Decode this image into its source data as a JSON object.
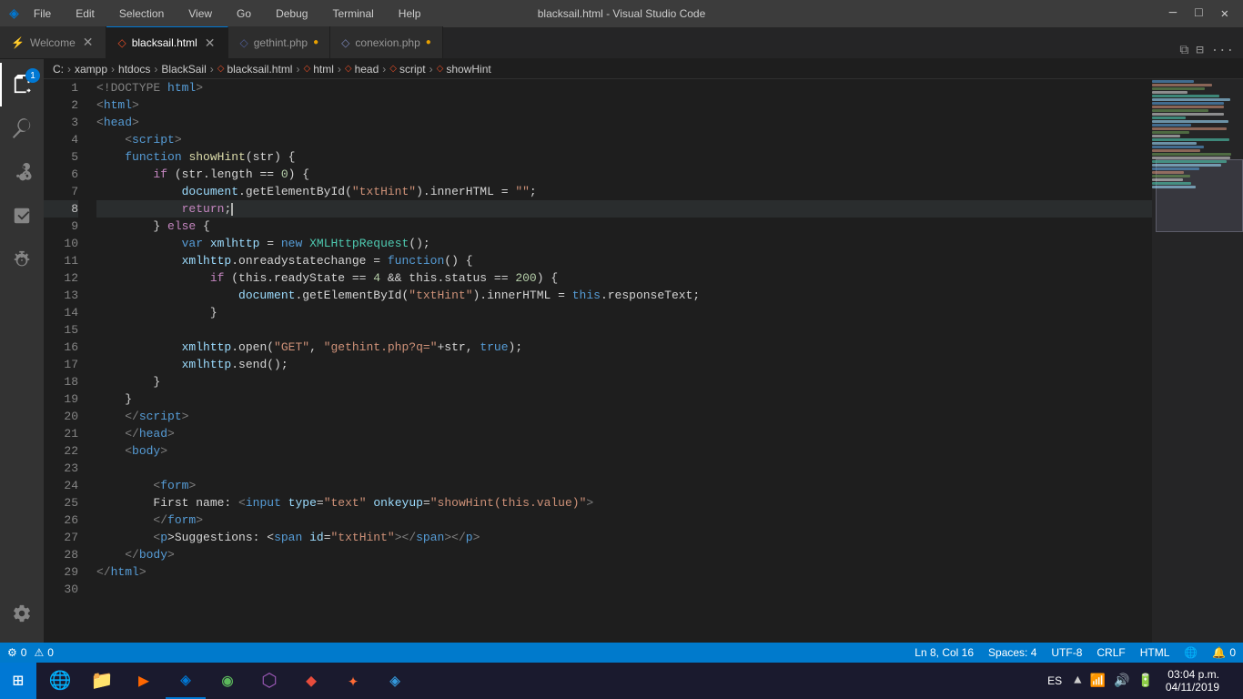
{
  "titlebar": {
    "menu_items": [
      "File",
      "Edit",
      "Selection",
      "View",
      "Go",
      "Debug",
      "Terminal",
      "Help"
    ],
    "title": "blacksail.html - Visual Studio Code",
    "controls": [
      "─",
      "□",
      "✕"
    ]
  },
  "tabs": [
    {
      "id": "welcome",
      "label": "Welcome",
      "icon": "⚡",
      "icon_color": "#75beff",
      "active": false,
      "modified": false
    },
    {
      "id": "blacksail",
      "label": "blacksail.html",
      "icon": "◇",
      "icon_color": "#e44d26",
      "active": true,
      "modified": false
    },
    {
      "id": "gethint",
      "label": "gethint.php",
      "icon": "◇",
      "icon_color": "#4f5d95",
      "active": false,
      "modified": true
    },
    {
      "id": "conexion",
      "label": "conexion.php",
      "icon": "◇",
      "icon_color": "#7a86b8",
      "active": false,
      "modified": true
    }
  ],
  "breadcrumb": {
    "items": [
      "C:",
      "xampp",
      "htdocs",
      "BlackSail",
      "blacksail.html",
      "html",
      "head",
      "script",
      "showHint"
    ]
  },
  "code": {
    "lines": [
      {
        "num": 1,
        "tokens": [
          {
            "t": "<!DOCTYPE ",
            "c": "c-gray"
          },
          {
            "t": "html",
            "c": "c-blue"
          },
          {
            "t": ">",
            "c": "c-gray"
          }
        ]
      },
      {
        "num": 2,
        "tokens": [
          {
            "t": "<",
            "c": "c-gray"
          },
          {
            "t": "html",
            "c": "c-tag-name"
          },
          {
            "t": ">",
            "c": "c-gray"
          }
        ]
      },
      {
        "num": 3,
        "tokens": [
          {
            "t": "<",
            "c": "c-gray"
          },
          {
            "t": "head",
            "c": "c-tag-name"
          },
          {
            "t": ">",
            "c": "c-gray"
          }
        ]
      },
      {
        "num": 4,
        "tokens": [
          {
            "t": "    <",
            "c": "c-gray"
          },
          {
            "t": "script",
            "c": "c-tag-name"
          },
          {
            "t": ">",
            "c": "c-gray"
          }
        ]
      },
      {
        "num": 5,
        "tokens": [
          {
            "t": "    ",
            "c": "c-white"
          },
          {
            "t": "function ",
            "c": "c-blue"
          },
          {
            "t": "showHint",
            "c": "c-yellow"
          },
          {
            "t": "(str) {",
            "c": "c-white"
          }
        ]
      },
      {
        "num": 6,
        "tokens": [
          {
            "t": "        ",
            "c": "c-white"
          },
          {
            "t": "if ",
            "c": "c-pink"
          },
          {
            "t": "(str.length == ",
            "c": "c-white"
          },
          {
            "t": "0",
            "c": "c-lt-green"
          },
          {
            "t": ") {",
            "c": "c-white"
          }
        ]
      },
      {
        "num": 7,
        "tokens": [
          {
            "t": "            ",
            "c": "c-white"
          },
          {
            "t": "document",
            "c": "c-lt-blue"
          },
          {
            "t": ".getElementById(",
            "c": "c-white"
          },
          {
            "t": "\"txtHint\"",
            "c": "c-orange"
          },
          {
            "t": ").innerHTML = ",
            "c": "c-white"
          },
          {
            "t": "\"\"",
            "c": "c-orange"
          },
          {
            "t": ";",
            "c": "c-white"
          }
        ]
      },
      {
        "num": 8,
        "tokens": [
          {
            "t": "            ",
            "c": "c-white"
          },
          {
            "t": "return",
            "c": "c-pink"
          },
          {
            "t": ";",
            "c": "c-white"
          }
        ],
        "current": true
      },
      {
        "num": 9,
        "tokens": [
          {
            "t": "        ",
            "c": "c-white"
          },
          {
            "t": "} ",
            "c": "c-white"
          },
          {
            "t": "else",
            "c": "c-pink"
          },
          {
            "t": " {",
            "c": "c-white"
          }
        ]
      },
      {
        "num": 10,
        "tokens": [
          {
            "t": "            ",
            "c": "c-white"
          },
          {
            "t": "var ",
            "c": "c-blue"
          },
          {
            "t": "xmlhttp ",
            "c": "c-lt-blue"
          },
          {
            "t": "= ",
            "c": "c-white"
          },
          {
            "t": "new ",
            "c": "c-blue"
          },
          {
            "t": "XMLHttpRequest",
            "c": "c-teal"
          },
          {
            "t": "();",
            "c": "c-white"
          }
        ]
      },
      {
        "num": 11,
        "tokens": [
          {
            "t": "            ",
            "c": "c-white"
          },
          {
            "t": "xmlhttp",
            "c": "c-lt-blue"
          },
          {
            "t": ".onreadystatechange = ",
            "c": "c-white"
          },
          {
            "t": "function",
            "c": "c-blue"
          },
          {
            "t": "() {",
            "c": "c-white"
          }
        ]
      },
      {
        "num": 12,
        "tokens": [
          {
            "t": "                ",
            "c": "c-white"
          },
          {
            "t": "if ",
            "c": "c-pink"
          },
          {
            "t": "(this.readyState == ",
            "c": "c-white"
          },
          {
            "t": "4",
            "c": "c-lt-green"
          },
          {
            "t": " && this.status == ",
            "c": "c-white"
          },
          {
            "t": "200",
            "c": "c-lt-green"
          },
          {
            "t": ") {",
            "c": "c-white"
          }
        ]
      },
      {
        "num": 13,
        "tokens": [
          {
            "t": "                    ",
            "c": "c-white"
          },
          {
            "t": "document",
            "c": "c-lt-blue"
          },
          {
            "t": ".getElementById(",
            "c": "c-white"
          },
          {
            "t": "\"txtHint\"",
            "c": "c-orange"
          },
          {
            "t": ").innerHTML = ",
            "c": "c-white"
          },
          {
            "t": "this",
            "c": "c-blue"
          },
          {
            "t": ".responseText;",
            "c": "c-white"
          }
        ]
      },
      {
        "num": 14,
        "tokens": [
          {
            "t": "                ",
            "c": "c-white"
          },
          {
            "t": "}",
            "c": "c-white"
          }
        ]
      },
      {
        "num": 15,
        "tokens": [
          {
            "t": "            ",
            "c": "c-white"
          }
        ]
      },
      {
        "num": 16,
        "tokens": [
          {
            "t": "            ",
            "c": "c-white"
          },
          {
            "t": "xmlhttp",
            "c": "c-lt-blue"
          },
          {
            "t": ".open(",
            "c": "c-white"
          },
          {
            "t": "\"GET\"",
            "c": "c-orange"
          },
          {
            "t": ", ",
            "c": "c-white"
          },
          {
            "t": "\"gethint.php?q=\"",
            "c": "c-orange"
          },
          {
            "t": "+str, ",
            "c": "c-white"
          },
          {
            "t": "true",
            "c": "c-blue"
          },
          {
            "t": ");",
            "c": "c-white"
          }
        ]
      },
      {
        "num": 17,
        "tokens": [
          {
            "t": "            ",
            "c": "c-white"
          },
          {
            "t": "xmlhttp",
            "c": "c-lt-blue"
          },
          {
            "t": ".send();",
            "c": "c-white"
          }
        ]
      },
      {
        "num": 18,
        "tokens": [
          {
            "t": "        ",
            "c": "c-white"
          },
          {
            "t": "}",
            "c": "c-white"
          }
        ]
      },
      {
        "num": 19,
        "tokens": [
          {
            "t": "    ",
            "c": "c-white"
          },
          {
            "t": "}",
            "c": "c-white"
          }
        ]
      },
      {
        "num": 20,
        "tokens": [
          {
            "t": "    </",
            "c": "c-gray"
          },
          {
            "t": "script",
            "c": "c-tag-name"
          },
          {
            "t": ">",
            "c": "c-gray"
          }
        ]
      },
      {
        "num": 21,
        "tokens": [
          {
            "t": "    </",
            "c": "c-gray"
          },
          {
            "t": "head",
            "c": "c-tag-name"
          },
          {
            "t": ">",
            "c": "c-gray"
          }
        ]
      },
      {
        "num": 22,
        "tokens": [
          {
            "t": "    <",
            "c": "c-gray"
          },
          {
            "t": "body",
            "c": "c-tag-name"
          },
          {
            "t": ">",
            "c": "c-gray"
          }
        ]
      },
      {
        "num": 23,
        "tokens": []
      },
      {
        "num": 24,
        "tokens": [
          {
            "t": "        <",
            "c": "c-gray"
          },
          {
            "t": "form",
            "c": "c-tag-name"
          },
          {
            "t": ">",
            "c": "c-gray"
          }
        ]
      },
      {
        "num": 25,
        "tokens": [
          {
            "t": "        ",
            "c": "c-white"
          },
          {
            "t": "First name: ",
            "c": "c-white"
          },
          {
            "t": "<",
            "c": "c-gray"
          },
          {
            "t": "input ",
            "c": "c-tag-name"
          },
          {
            "t": "type",
            "c": "c-attr"
          },
          {
            "t": "=",
            "c": "c-white"
          },
          {
            "t": "\"text\"",
            "c": "c-orange"
          },
          {
            "t": " onkeyup",
            "c": "c-attr"
          },
          {
            "t": "=",
            "c": "c-white"
          },
          {
            "t": "\"showHint(this.value)\"",
            "c": "c-orange"
          },
          {
            "t": ">",
            "c": "c-gray"
          }
        ]
      },
      {
        "num": 26,
        "tokens": [
          {
            "t": "        </",
            "c": "c-gray"
          },
          {
            "t": "form",
            "c": "c-tag-name"
          },
          {
            "t": ">",
            "c": "c-gray"
          }
        ]
      },
      {
        "num": 27,
        "tokens": [
          {
            "t": "        <",
            "c": "c-gray"
          },
          {
            "t": "p",
            "c": "c-tag-name"
          },
          {
            "t": ">Suggestions: <",
            "c": "c-white"
          },
          {
            "t": "span ",
            "c": "c-tag-name"
          },
          {
            "t": "id",
            "c": "c-attr"
          },
          {
            "t": "=",
            "c": "c-white"
          },
          {
            "t": "\"txtHint\"",
            "c": "c-orange"
          },
          {
            "t": "></",
            "c": "c-gray"
          },
          {
            "t": "span",
            "c": "c-tag-name"
          },
          {
            "t": "></",
            "c": "c-gray"
          },
          {
            "t": "p",
            "c": "c-tag-name"
          },
          {
            "t": ">",
            "c": "c-gray"
          }
        ]
      },
      {
        "num": 28,
        "tokens": [
          {
            "t": "    </",
            "c": "c-gray"
          },
          {
            "t": "body",
            "c": "c-tag-name"
          },
          {
            "t": ">",
            "c": "c-gray"
          }
        ]
      },
      {
        "num": 29,
        "tokens": [
          {
            "t": "</",
            "c": "c-gray"
          },
          {
            "t": "html",
            "c": "c-tag-name"
          },
          {
            "t": ">",
            "c": "c-gray"
          }
        ]
      },
      {
        "num": 30,
        "tokens": []
      }
    ]
  },
  "statusbar": {
    "left": [
      {
        "icon": "⚙",
        "label": "0",
        "type": "errors"
      },
      {
        "icon": "⚠",
        "label": "0",
        "type": "warnings"
      }
    ],
    "right": [
      {
        "label": "Ln 8, Col 16"
      },
      {
        "label": "Spaces: 4"
      },
      {
        "label": "UTF-8"
      },
      {
        "label": "CRLF"
      },
      {
        "label": "HTML"
      },
      {
        "icon": "🌐",
        "label": ""
      },
      {
        "icon": "🔔",
        "label": "0"
      }
    ]
  },
  "taskbar": {
    "apps": [
      {
        "id": "start",
        "icon": "⊞",
        "color": "#0078d4"
      },
      {
        "id": "chrome",
        "icon": "●",
        "color": "#4285f4"
      },
      {
        "id": "explorer",
        "icon": "📁",
        "color": "#ffd700"
      },
      {
        "id": "media",
        "icon": "▶",
        "color": "#ff6600"
      },
      {
        "id": "vscode",
        "icon": "◈",
        "color": "#0078d4",
        "active": true
      },
      {
        "id": "app5",
        "icon": "◉",
        "color": "#5cb85c"
      },
      {
        "id": "app6",
        "icon": "⬡",
        "color": "#9b59b6"
      },
      {
        "id": "app7",
        "icon": "◆",
        "color": "#e74c3c"
      },
      {
        "id": "xampp",
        "icon": "✦",
        "color": "#ff6b35"
      },
      {
        "id": "app9",
        "icon": "◈",
        "color": "#3498db"
      }
    ],
    "tray": {
      "lang": "ES",
      "time": "03:04 p.m.",
      "date": "04/11/2019"
    }
  },
  "activity_icons": [
    "files",
    "search",
    "source-control",
    "extensions",
    "debug",
    "settings"
  ]
}
